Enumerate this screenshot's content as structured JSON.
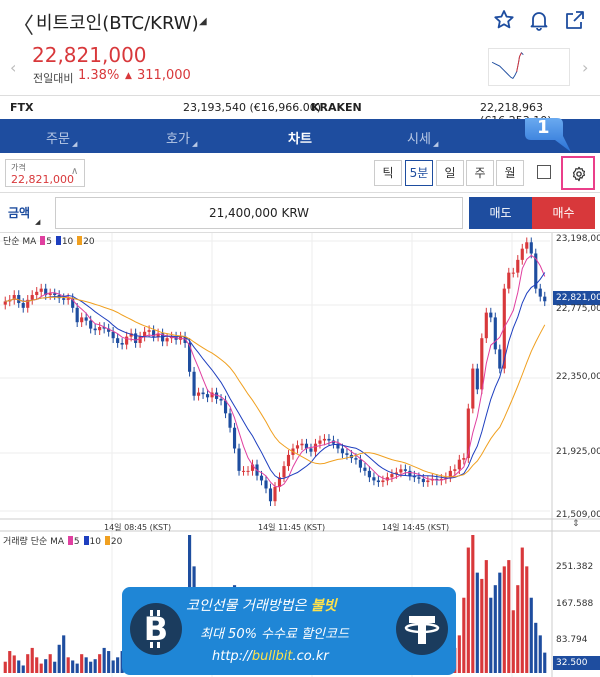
{
  "header": {
    "title": "비트코인(BTC/KRW)",
    "icons": [
      "back-icon",
      "star-icon",
      "bell-icon",
      "share-icon"
    ]
  },
  "ticker": {
    "price": "22,821,000",
    "prev_label": "전일대비",
    "change_pct": "1.38%",
    "change_amount": "311,000"
  },
  "exchanges": [
    {
      "name": "FTX",
      "value": "23,193,540 (€16,966.00)"
    },
    {
      "name": "KRAKEN",
      "value": "22,218,963 (€16,253.10)"
    }
  ],
  "tabs": [
    {
      "label": "주문",
      "active": false
    },
    {
      "label": "호가",
      "active": false
    },
    {
      "label": "차트",
      "active": true
    },
    {
      "label": "시세",
      "active": false
    }
  ],
  "controls": {
    "price_label": "가격",
    "price_value": "22,821,000",
    "intervals": [
      "틱",
      "5분",
      "일",
      "주",
      "월"
    ],
    "selected_interval": "5분",
    "callout_badge": "1"
  },
  "amount": {
    "label": "금액",
    "value": "21,400,000 KRW",
    "sell_label": "매도",
    "buy_label": "매수"
  },
  "chart": {
    "legend": {
      "prefix": "단순 MA",
      "p5": "5",
      "p10": "10",
      "p20": "20"
    },
    "y_labels": [
      "23,198,000",
      "22,821,000",
      "22,775,000",
      "22,350,000",
      "21,925,000",
      "21,509,000"
    ],
    "x_labels": [
      "14일 08:45 (KST)",
      "14일 11:45 (KST)",
      "14일 14:45 (KST)"
    ],
    "volume_legend": {
      "prefix": "거래량 단순 MA",
      "p5": "5",
      "p10": "10",
      "p20": "20"
    },
    "volume_y_labels": [
      "251.382",
      "167.588",
      "83.794",
      "32.500"
    ],
    "colors": {
      "up": "#d8383b",
      "down": "#1e4d9f",
      "ma5": "#e040a0",
      "ma10": "#1e3fbf",
      "ma20": "#f0a020"
    }
  },
  "chart_data": {
    "type": "candlestick",
    "ylim": [
      21509000,
      23198000
    ],
    "close_series": [
      22820000,
      22830000,
      22860000,
      22810000,
      22780000,
      22830000,
      22860000,
      22880000,
      22900000,
      22860000,
      22870000,
      22860000,
      22840000,
      22830000,
      22840000,
      22780000,
      22690000,
      22720000,
      22700000,
      22650000,
      22640000,
      22660000,
      22650000,
      22630000,
      22590000,
      22560000,
      22550000,
      22600000,
      22620000,
      22560000,
      22600000,
      22630000,
      22640000,
      22600000,
      22620000,
      22570000,
      22590000,
      22600000,
      22580000,
      22600000,
      22560000,
      22380000,
      22230000,
      22250000,
      22240000,
      22220000,
      22250000,
      22210000,
      22200000,
      22120000,
      22030000,
      21900000,
      21760000,
      21760000,
      21760000,
      21800000,
      21730000,
      21700000,
      21650000,
      21570000,
      21660000,
      21720000,
      21790000,
      21860000,
      21900000,
      21920000,
      21930000,
      21900000,
      21880000,
      21930000,
      21950000,
      21960000,
      21950000,
      21930000,
      21900000,
      21870000,
      21860000,
      21840000,
      21830000,
      21780000,
      21760000,
      21720000,
      21700000,
      21690000,
      21700000,
      21720000,
      21740000,
      21750000,
      21770000,
      21760000,
      21730000,
      21720000,
      21710000,
      21690000,
      21700000,
      21710000,
      21700000,
      21710000,
      21720000,
      21760000,
      21770000,
      21830000,
      21840000,
      22150000,
      22400000,
      22270000,
      22590000,
      22750000,
      22720000,
      22520000,
      22400000,
      22900000,
      23000000,
      23000000,
      23080000,
      23150000,
      23190000,
      23120000,
      22900000,
      22850000,
      22821000
    ],
    "volume": [
      18,
      35,
      28,
      20,
      12,
      30,
      40,
      25,
      15,
      22,
      30,
      18,
      45,
      60,
      25,
      20,
      15,
      30,
      25,
      18,
      22,
      30,
      40,
      35,
      20,
      25,
      35,
      55,
      40,
      30,
      25,
      20,
      30,
      35,
      40,
      60,
      55,
      40,
      35,
      30,
      90,
      220,
      170,
      120,
      60,
      80,
      100,
      130,
      90,
      40,
      120,
      140,
      100,
      60,
      40,
      60,
      50,
      70,
      90,
      60,
      80,
      40,
      30,
      60,
      70,
      50,
      40,
      30,
      20,
      30,
      50,
      40,
      60,
      30,
      20,
      40,
      50,
      60,
      30,
      20,
      40,
      50,
      60,
      40,
      30,
      20,
      30,
      60,
      50,
      40,
      70,
      30,
      20,
      40,
      30,
      20,
      30,
      40,
      60,
      70,
      40,
      60,
      120,
      200,
      220,
      160,
      150,
      180,
      120,
      140,
      160,
      170,
      180,
      100,
      140,
      200,
      170,
      120,
      80,
      60,
      32.5
    ]
  }
}
